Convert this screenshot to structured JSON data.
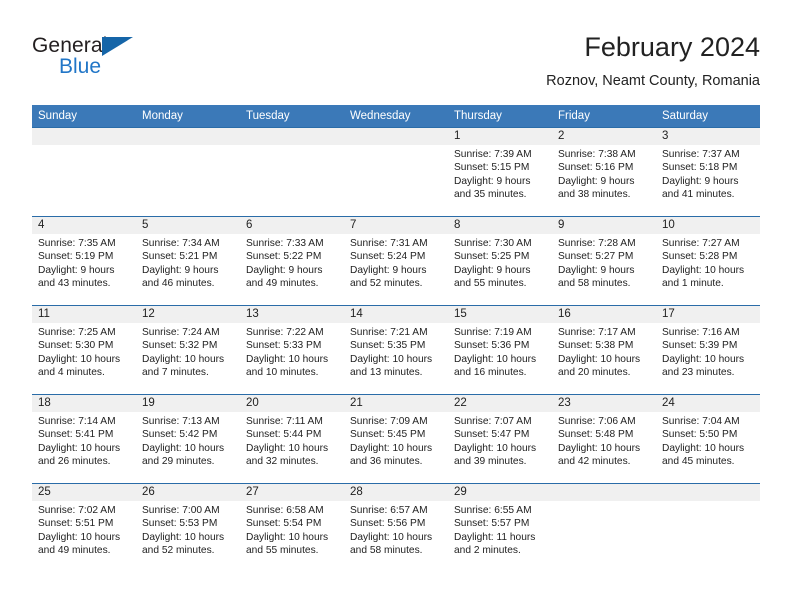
{
  "brand": {
    "name_part1": "General",
    "name_part2": "Blue",
    "flag_icon": "blue-triangle-flag",
    "accent_color": "#2176c7"
  },
  "header": {
    "title": "February 2024",
    "subtitle": "Roznov, Neamt County, Romania"
  },
  "theme": {
    "header_bg": "#3b79b8",
    "row_border": "#2a6ca8",
    "daynum_bg": "#f0f0f0",
    "text": "#222222"
  },
  "calendar": {
    "weekday_headers": [
      "Sunday",
      "Monday",
      "Tuesday",
      "Wednesday",
      "Thursday",
      "Friday",
      "Saturday"
    ],
    "weeks": [
      [
        {
          "day": "",
          "empty": true,
          "sunrise": "",
          "sunset": "",
          "daylight_line1": "",
          "daylight_line2": ""
        },
        {
          "day": "",
          "empty": true,
          "sunrise": "",
          "sunset": "",
          "daylight_line1": "",
          "daylight_line2": ""
        },
        {
          "day": "",
          "empty": true,
          "sunrise": "",
          "sunset": "",
          "daylight_line1": "",
          "daylight_line2": ""
        },
        {
          "day": "",
          "empty": true,
          "sunrise": "",
          "sunset": "",
          "daylight_line1": "",
          "daylight_line2": ""
        },
        {
          "day": "1",
          "empty": false,
          "sunrise": "Sunrise: 7:39 AM",
          "sunset": "Sunset: 5:15 PM",
          "daylight_line1": "Daylight: 9 hours",
          "daylight_line2": "and 35 minutes."
        },
        {
          "day": "2",
          "empty": false,
          "sunrise": "Sunrise: 7:38 AM",
          "sunset": "Sunset: 5:16 PM",
          "daylight_line1": "Daylight: 9 hours",
          "daylight_line2": "and 38 minutes."
        },
        {
          "day": "3",
          "empty": false,
          "sunrise": "Sunrise: 7:37 AM",
          "sunset": "Sunset: 5:18 PM",
          "daylight_line1": "Daylight: 9 hours",
          "daylight_line2": "and 41 minutes."
        }
      ],
      [
        {
          "day": "4",
          "empty": false,
          "sunrise": "Sunrise: 7:35 AM",
          "sunset": "Sunset: 5:19 PM",
          "daylight_line1": "Daylight: 9 hours",
          "daylight_line2": "and 43 minutes."
        },
        {
          "day": "5",
          "empty": false,
          "sunrise": "Sunrise: 7:34 AM",
          "sunset": "Sunset: 5:21 PM",
          "daylight_line1": "Daylight: 9 hours",
          "daylight_line2": "and 46 minutes."
        },
        {
          "day": "6",
          "empty": false,
          "sunrise": "Sunrise: 7:33 AM",
          "sunset": "Sunset: 5:22 PM",
          "daylight_line1": "Daylight: 9 hours",
          "daylight_line2": "and 49 minutes."
        },
        {
          "day": "7",
          "empty": false,
          "sunrise": "Sunrise: 7:31 AM",
          "sunset": "Sunset: 5:24 PM",
          "daylight_line1": "Daylight: 9 hours",
          "daylight_line2": "and 52 minutes."
        },
        {
          "day": "8",
          "empty": false,
          "sunrise": "Sunrise: 7:30 AM",
          "sunset": "Sunset: 5:25 PM",
          "daylight_line1": "Daylight: 9 hours",
          "daylight_line2": "and 55 minutes."
        },
        {
          "day": "9",
          "empty": false,
          "sunrise": "Sunrise: 7:28 AM",
          "sunset": "Sunset: 5:27 PM",
          "daylight_line1": "Daylight: 9 hours",
          "daylight_line2": "and 58 minutes."
        },
        {
          "day": "10",
          "empty": false,
          "sunrise": "Sunrise: 7:27 AM",
          "sunset": "Sunset: 5:28 PM",
          "daylight_line1": "Daylight: 10 hours",
          "daylight_line2": "and 1 minute."
        }
      ],
      [
        {
          "day": "11",
          "empty": false,
          "sunrise": "Sunrise: 7:25 AM",
          "sunset": "Sunset: 5:30 PM",
          "daylight_line1": "Daylight: 10 hours",
          "daylight_line2": "and 4 minutes."
        },
        {
          "day": "12",
          "empty": false,
          "sunrise": "Sunrise: 7:24 AM",
          "sunset": "Sunset: 5:32 PM",
          "daylight_line1": "Daylight: 10 hours",
          "daylight_line2": "and 7 minutes."
        },
        {
          "day": "13",
          "empty": false,
          "sunrise": "Sunrise: 7:22 AM",
          "sunset": "Sunset: 5:33 PM",
          "daylight_line1": "Daylight: 10 hours",
          "daylight_line2": "and 10 minutes."
        },
        {
          "day": "14",
          "empty": false,
          "sunrise": "Sunrise: 7:21 AM",
          "sunset": "Sunset: 5:35 PM",
          "daylight_line1": "Daylight: 10 hours",
          "daylight_line2": "and 13 minutes."
        },
        {
          "day": "15",
          "empty": false,
          "sunrise": "Sunrise: 7:19 AM",
          "sunset": "Sunset: 5:36 PM",
          "daylight_line1": "Daylight: 10 hours",
          "daylight_line2": "and 16 minutes."
        },
        {
          "day": "16",
          "empty": false,
          "sunrise": "Sunrise: 7:17 AM",
          "sunset": "Sunset: 5:38 PM",
          "daylight_line1": "Daylight: 10 hours",
          "daylight_line2": "and 20 minutes."
        },
        {
          "day": "17",
          "empty": false,
          "sunrise": "Sunrise: 7:16 AM",
          "sunset": "Sunset: 5:39 PM",
          "daylight_line1": "Daylight: 10 hours",
          "daylight_line2": "and 23 minutes."
        }
      ],
      [
        {
          "day": "18",
          "empty": false,
          "sunrise": "Sunrise: 7:14 AM",
          "sunset": "Sunset: 5:41 PM",
          "daylight_line1": "Daylight: 10 hours",
          "daylight_line2": "and 26 minutes."
        },
        {
          "day": "19",
          "empty": false,
          "sunrise": "Sunrise: 7:13 AM",
          "sunset": "Sunset: 5:42 PM",
          "daylight_line1": "Daylight: 10 hours",
          "daylight_line2": "and 29 minutes."
        },
        {
          "day": "20",
          "empty": false,
          "sunrise": "Sunrise: 7:11 AM",
          "sunset": "Sunset: 5:44 PM",
          "daylight_line1": "Daylight: 10 hours",
          "daylight_line2": "and 32 minutes."
        },
        {
          "day": "21",
          "empty": false,
          "sunrise": "Sunrise: 7:09 AM",
          "sunset": "Sunset: 5:45 PM",
          "daylight_line1": "Daylight: 10 hours",
          "daylight_line2": "and 36 minutes."
        },
        {
          "day": "22",
          "empty": false,
          "sunrise": "Sunrise: 7:07 AM",
          "sunset": "Sunset: 5:47 PM",
          "daylight_line1": "Daylight: 10 hours",
          "daylight_line2": "and 39 minutes."
        },
        {
          "day": "23",
          "empty": false,
          "sunrise": "Sunrise: 7:06 AM",
          "sunset": "Sunset: 5:48 PM",
          "daylight_line1": "Daylight: 10 hours",
          "daylight_line2": "and 42 minutes."
        },
        {
          "day": "24",
          "empty": false,
          "sunrise": "Sunrise: 7:04 AM",
          "sunset": "Sunset: 5:50 PM",
          "daylight_line1": "Daylight: 10 hours",
          "daylight_line2": "and 45 minutes."
        }
      ],
      [
        {
          "day": "25",
          "empty": false,
          "sunrise": "Sunrise: 7:02 AM",
          "sunset": "Sunset: 5:51 PM",
          "daylight_line1": "Daylight: 10 hours",
          "daylight_line2": "and 49 minutes."
        },
        {
          "day": "26",
          "empty": false,
          "sunrise": "Sunrise: 7:00 AM",
          "sunset": "Sunset: 5:53 PM",
          "daylight_line1": "Daylight: 10 hours",
          "daylight_line2": "and 52 minutes."
        },
        {
          "day": "27",
          "empty": false,
          "sunrise": "Sunrise: 6:58 AM",
          "sunset": "Sunset: 5:54 PM",
          "daylight_line1": "Daylight: 10 hours",
          "daylight_line2": "and 55 minutes."
        },
        {
          "day": "28",
          "empty": false,
          "sunrise": "Sunrise: 6:57 AM",
          "sunset": "Sunset: 5:56 PM",
          "daylight_line1": "Daylight: 10 hours",
          "daylight_line2": "and 58 minutes."
        },
        {
          "day": "29",
          "empty": false,
          "sunrise": "Sunrise: 6:55 AM",
          "sunset": "Sunset: 5:57 PM",
          "daylight_line1": "Daylight: 11 hours",
          "daylight_line2": "and 2 minutes."
        },
        {
          "day": "",
          "empty": true,
          "sunrise": "",
          "sunset": "",
          "daylight_line1": "",
          "daylight_line2": ""
        },
        {
          "day": "",
          "empty": true,
          "sunrise": "",
          "sunset": "",
          "daylight_line1": "",
          "daylight_line2": ""
        }
      ]
    ]
  }
}
